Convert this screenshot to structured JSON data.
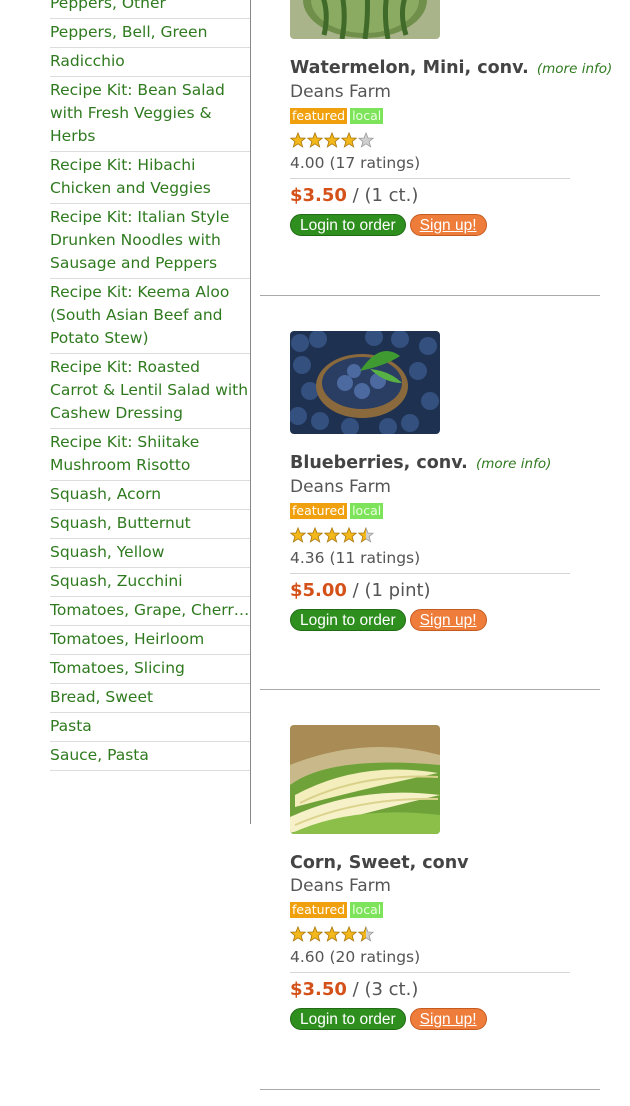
{
  "sidebar": {
    "items": [
      "Peppers, Other",
      "Peppers, Bell, Green",
      "Radicchio",
      "Recipe Kit: Bean Salad with Fresh Veggies & Herbs",
      "Recipe Kit: Hibachi Chicken and Veggies",
      "Recipe Kit: Italian Style Drunken Noodles with Sausage and Peppers",
      "Recipe Kit: Keema Aloo (South Asian Beef and Potato Stew)",
      "Recipe Kit: Roasted Carrot & Lentil Salad with Cashew Dressing",
      "Recipe Kit: Shiitake Mushroom Risotto",
      "Squash, Acorn",
      "Squash, Butternut",
      "Squash, Yellow",
      "Squash, Zucchini",
      "Tomatoes, Grape, Cherry…",
      "Tomatoes, Heirloom",
      "Tomatoes, Slicing",
      "Bread, Sweet",
      "Pasta",
      "Sauce, Pasta"
    ]
  },
  "common": {
    "more_info": "(more info)",
    "featured": "featured",
    "local": "local",
    "login": "Login to order",
    "signup": "Sign up!"
  },
  "products": [
    {
      "name": "Watermelon, Mini, conv.",
      "has_more_info": true,
      "farm": "Deans Farm",
      "rating": 4.0,
      "rating_text": "4.00 (17 ratings)",
      "price": "$3.50",
      "unit": "/ (1 ct.)",
      "image": "watermelon"
    },
    {
      "name": "Blueberries, conv.",
      "has_more_info": true,
      "farm": "Deans Farm",
      "rating": 4.36,
      "rating_text": "4.36 (11 ratings)",
      "price": "$5.00",
      "unit": "/ (1 pint)",
      "image": "blueberries"
    },
    {
      "name": "Corn, Sweet, conv",
      "has_more_info": false,
      "farm": "Deans Farm",
      "rating": 4.6,
      "rating_text": "4.60 (20 ratings)",
      "price": "$3.50",
      "unit": "/ (3 ct.)",
      "image": "corn"
    }
  ],
  "colors": {
    "link_green": "#2f7a1f",
    "price_orange": "#d4521a",
    "featured_tag": "#f0a00c",
    "local_tag": "#7ce35a",
    "login_button": "#2e8f1f",
    "signup_button": "#ee7c3a",
    "star_gold": "#f2b81c",
    "star_empty": "#cfcfcf"
  }
}
